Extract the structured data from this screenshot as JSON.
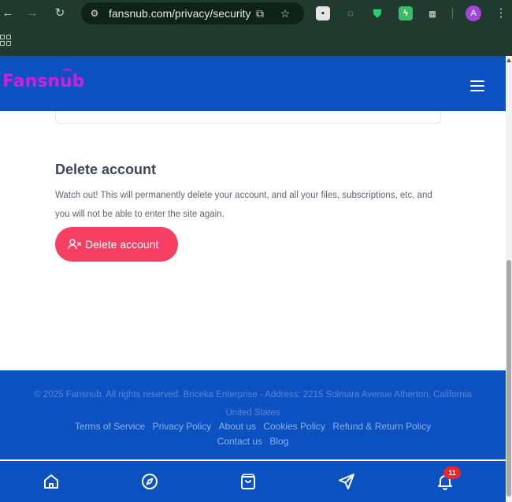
{
  "browser": {
    "url": "fansnub.com/privacy/security",
    "avatar_letter": "A"
  },
  "header": {
    "logo_text": "Fansnub"
  },
  "delete_section": {
    "title": "Delete account",
    "description": "Watch out! This will permanently delete your account, and all your files, subscriptions, etc, and you will not be able to enter the site again.",
    "button_label": "Delete account"
  },
  "footer": {
    "copyright": "© 2025 Fansnub, All rights reserved. Briceka Enterprise - Address: 2215 Solmara Avenue Atherton, California United States",
    "links": [
      "Terms of Service",
      "Privacy Policy",
      "About us",
      "Cookies Policy",
      "Refund & Return Policy",
      "Contact us",
      "Blog"
    ]
  },
  "bottom_nav": {
    "notification_count": "11"
  },
  "colors": {
    "brand_blue": "#0c51c1",
    "logo_magenta": "#d11ed8",
    "danger": "#f73e63",
    "badge_red": "#e8262f"
  }
}
